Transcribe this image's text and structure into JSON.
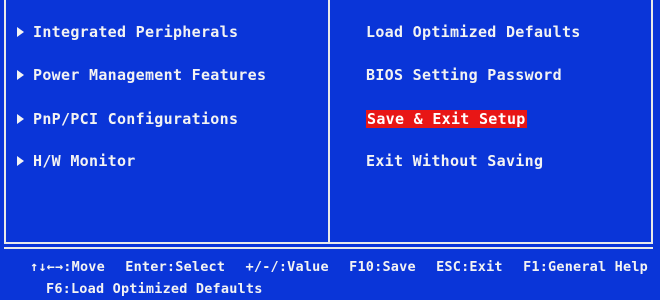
{
  "left_menu": [
    {
      "label": "Integrated Peripherals"
    },
    {
      "label": "Power Management Features"
    },
    {
      "label": "PnP/PCI Configurations"
    },
    {
      "label": "H/W Monitor"
    }
  ],
  "right_menu": [
    {
      "label": "Load Optimized Defaults",
      "selected": false
    },
    {
      "label": "BIOS Setting Password",
      "selected": false
    },
    {
      "label": "Save & Exit Setup",
      "selected": true
    },
    {
      "label": "Exit Without Saving",
      "selected": false
    }
  ],
  "help_bar": {
    "row1": [
      "↑↓←→:Move",
      "Enter:Select",
      "+/-/:Value",
      "F10:Save",
      "ESC:Exit",
      "F1:General Help"
    ],
    "row2": [
      "F6:Load Optimized Defaults"
    ]
  },
  "colors": {
    "background": "#0a35d8",
    "highlight": "#e81616",
    "text": "#f3f3f3"
  }
}
